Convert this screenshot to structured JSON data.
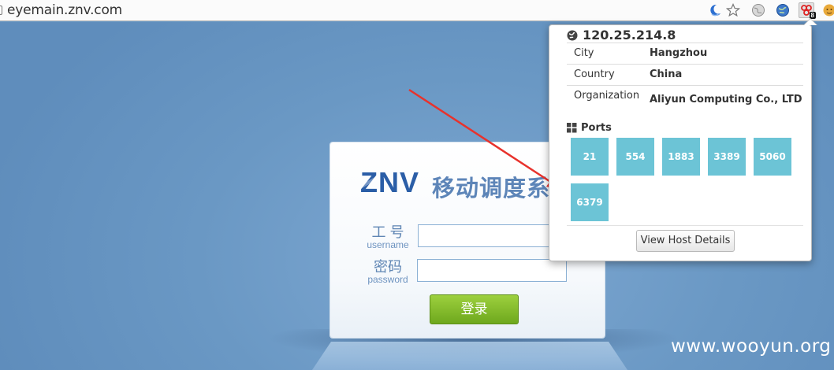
{
  "browser": {
    "url": "eyemain.znv.com",
    "toolbar_icons": [
      "moon-extension-icon",
      "bookmark-star-icon",
      "globe-gray-extension-icon",
      "globe-blue-extension-icon",
      "shodan-extension-icon",
      "avatar-extension-icon"
    ],
    "shodan_badge": "8"
  },
  "login": {
    "brand_logo": "ZNV",
    "title": "移动调度系统",
    "username_label_cn": "工 号",
    "username_label_en": "username",
    "username_value": "",
    "password_label_cn": "密码",
    "password_label_en": "password",
    "password_value": "",
    "submit_label": "登录"
  },
  "shodan_popup": {
    "ip": "120.25.214.8",
    "info": [
      {
        "key": "City",
        "value": "Hangzhou"
      },
      {
        "key": "Country",
        "value": "China"
      },
      {
        "key": "Organization",
        "value": "Aliyun Computing Co., LTD"
      }
    ],
    "ports_heading": "Ports",
    "ports": [
      "21",
      "554",
      "1883",
      "3389",
      "5060",
      "6379"
    ],
    "details_button": "View Host Details"
  },
  "annotation": {
    "arrow_color": "#e8322c",
    "arrow_target": "port-6379"
  },
  "watermark": "www.wooyun.org",
  "colors": {
    "port_tile": "#6cc4d6",
    "login_button": "#7cb527",
    "brand_blue": "#5d85b8",
    "page_background": "#6a98c4"
  }
}
